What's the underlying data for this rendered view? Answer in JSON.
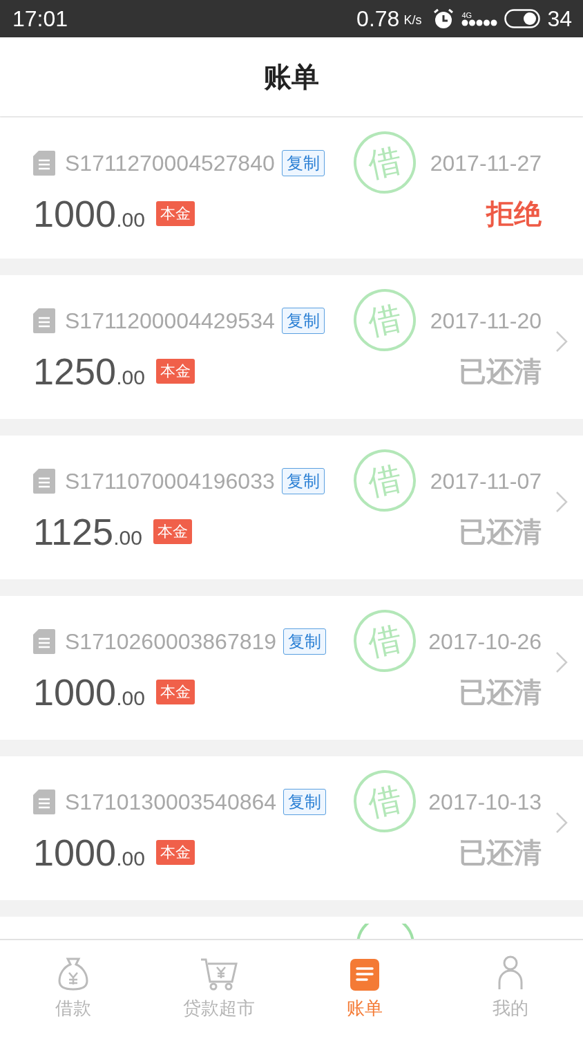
{
  "status_bar": {
    "time": "17:01",
    "speed": "0.78",
    "speed_unit": "K/s",
    "network": "4G",
    "battery": "34"
  },
  "header": {
    "title": "账单"
  },
  "bills": [
    {
      "order_no": "S1711270004527840",
      "copy_label": "复制",
      "date": "2017-11-27",
      "amount": "1000",
      "decimals": ".00",
      "tag": "本金",
      "stamp": "借",
      "status": "拒绝",
      "kind": "rejected"
    },
    {
      "order_no": "S1711200004429534",
      "copy_label": "复制",
      "date": "2017-11-20",
      "amount": "1250",
      "decimals": ".00",
      "tag": "本金",
      "stamp": "借",
      "status": "已还清",
      "kind": "paid"
    },
    {
      "order_no": "S1711070004196033",
      "copy_label": "复制",
      "date": "2017-11-07",
      "amount": "1125",
      "decimals": ".00",
      "tag": "本金",
      "stamp": "借",
      "status": "已还清",
      "kind": "paid"
    },
    {
      "order_no": "S1710260003867819",
      "copy_label": "复制",
      "date": "2017-10-26",
      "amount": "1000",
      "decimals": ".00",
      "tag": "本金",
      "stamp": "借",
      "status": "已还清",
      "kind": "paid"
    },
    {
      "order_no": "S1710130003540864",
      "copy_label": "复制",
      "date": "2017-10-13",
      "amount": "1000",
      "decimals": ".00",
      "tag": "本金",
      "stamp": "借",
      "status": "已还清",
      "kind": "paid"
    }
  ],
  "tabs": [
    {
      "label": "借款",
      "kind": "bag",
      "selected": false
    },
    {
      "label": "贷款超市",
      "kind": "cart",
      "selected": false
    },
    {
      "label": "账单",
      "kind": "bill",
      "selected": true
    },
    {
      "label": "我的",
      "kind": "person",
      "selected": false
    }
  ]
}
